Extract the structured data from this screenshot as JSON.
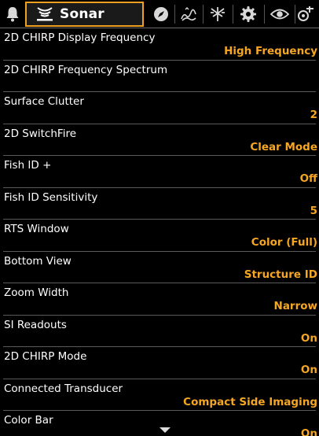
{
  "tabs": {
    "alerts_icon": "bell-icon",
    "sonar_icon": "sonar-icon",
    "sonar_label": "Sonar",
    "navigation_icon": "compass-icon",
    "chart_icon": "chart-icon",
    "network_icon": "network-icon",
    "settings_icon": "gear-icon",
    "views_icon": "eye-icon",
    "accessories_icon": "accessories-icon",
    "active_color": "#f0a020"
  },
  "menu": {
    "value_color": "#f5a623",
    "items": [
      {
        "label": "2D CHIRP Display Frequency",
        "value": "High Frequency"
      },
      {
        "label": "2D CHIRP Frequency Spectrum",
        "value": ""
      },
      {
        "label": "Surface Clutter",
        "value": "2"
      },
      {
        "label": "2D SwitchFire",
        "value": "Clear Mode"
      },
      {
        "label": "Fish ID +",
        "value": "Off"
      },
      {
        "label": "Fish ID Sensitivity",
        "value": "5"
      },
      {
        "label": "RTS Window",
        "value": "Color (Full)"
      },
      {
        "label": "Bottom View",
        "value": "Structure ID"
      },
      {
        "label": "Zoom Width",
        "value": "Narrow"
      },
      {
        "label": "SI Readouts",
        "value": "On"
      },
      {
        "label": "2D CHIRP Mode",
        "value": "On"
      },
      {
        "label": "Connected Transducer",
        "value": "Compact Side Imaging"
      },
      {
        "label": "Color Bar",
        "value": "On"
      }
    ]
  },
  "scroll": {
    "more_icon": "chevron-down-icon"
  }
}
